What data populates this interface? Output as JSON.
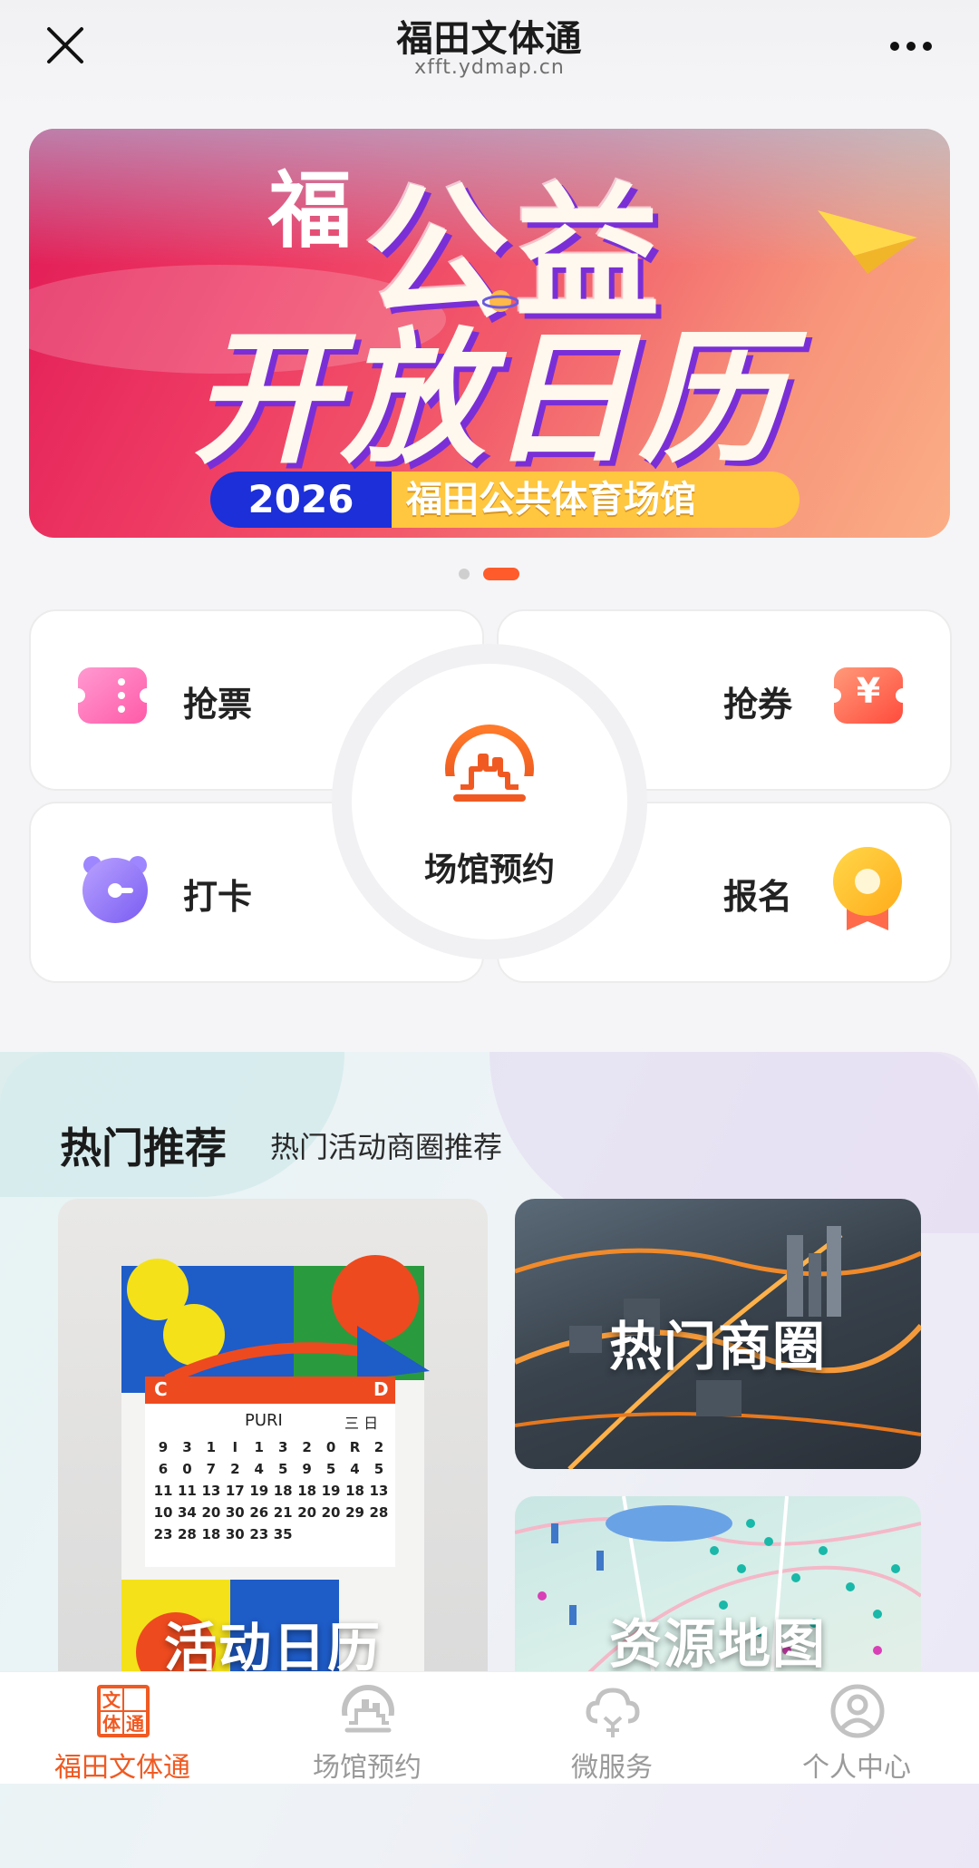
{
  "header": {
    "title": "福田文体通",
    "url": "xfft.ydmap.cn"
  },
  "banner": {
    "logo": "福",
    "line1": "公益",
    "line2": "开放日历",
    "year": "2026",
    "venue": "福田公共体育场馆"
  },
  "carousel": {
    "count": 2,
    "active_index": 1
  },
  "quick_actions": {
    "grab_tickets": "抢票",
    "grab_coupons": "抢券",
    "check_in": "打卡",
    "sign_up": "报名",
    "venue_booking": "场馆预约",
    "coupon_symbol": "¥"
  },
  "hot": {
    "title": "热门推荐",
    "subtitle": "热门活动商圈推荐",
    "tiles": [
      {
        "label": "活动日历"
      },
      {
        "label": "热门商圈"
      },
      {
        "label": "资源地图"
      }
    ]
  },
  "calendar_art": {
    "left_letter": "C",
    "right_letter": "D",
    "header_text": "PURI",
    "header_right": "三 日",
    "rows": [
      [
        "9",
        "3",
        "1",
        "I",
        "1",
        "3",
        "2",
        "0",
        "R",
        "2"
      ],
      [
        "6",
        "0",
        "7",
        "2",
        "4",
        "5",
        "9",
        "5",
        "4",
        "5"
      ],
      [
        "11",
        "11",
        "13",
        "17",
        "19",
        "18",
        "18",
        "19",
        "18",
        "13"
      ],
      [
        "10",
        "34",
        "20",
        "30",
        "26",
        "21",
        "20",
        "20",
        "29",
        "28"
      ],
      [
        "23",
        "28",
        "18",
        "30",
        "23",
        "35",
        "",
        "",
        "",
        ""
      ]
    ]
  },
  "bottom_nav": [
    {
      "label": "福田文体通",
      "active": true,
      "icon": "futian-logo-icon"
    },
    {
      "label": "场馆预约",
      "active": false,
      "icon": "venue-icon"
    },
    {
      "label": "微服务",
      "active": false,
      "icon": "cloud-service-icon"
    },
    {
      "label": "个人中心",
      "active": false,
      "icon": "user-profile-icon"
    }
  ],
  "colors": {
    "accent": "#f05a22",
    "active_dot": "#ff5b2b",
    "banner_blue": "#1c2fd9",
    "banner_yellow": "#ffc640"
  }
}
